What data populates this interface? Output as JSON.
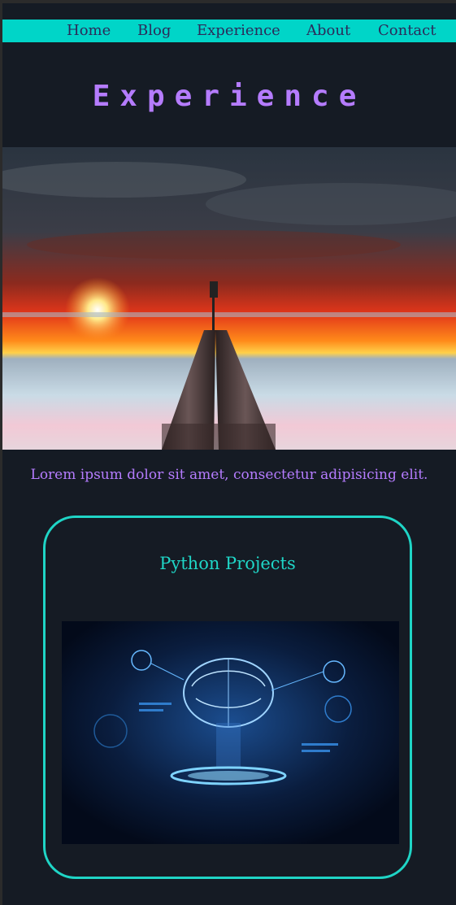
{
  "nav": {
    "items": [
      "Home",
      "Blog",
      "Experience",
      "About",
      "Contact"
    ]
  },
  "page": {
    "title": "Experience",
    "lead": "Lorem ipsum dolor sit amet, consectetur adipisicing elit."
  },
  "card": {
    "title": "Python Projects"
  },
  "images": {
    "hero": "sunset-sea-pipes-image",
    "card": "ai-brain-technology-image"
  },
  "colors": {
    "page_bg": "#151b24",
    "nav_bg": "#00d5c8",
    "accent_purple": "#b57cff",
    "accent_teal": "#1fd5c6"
  }
}
